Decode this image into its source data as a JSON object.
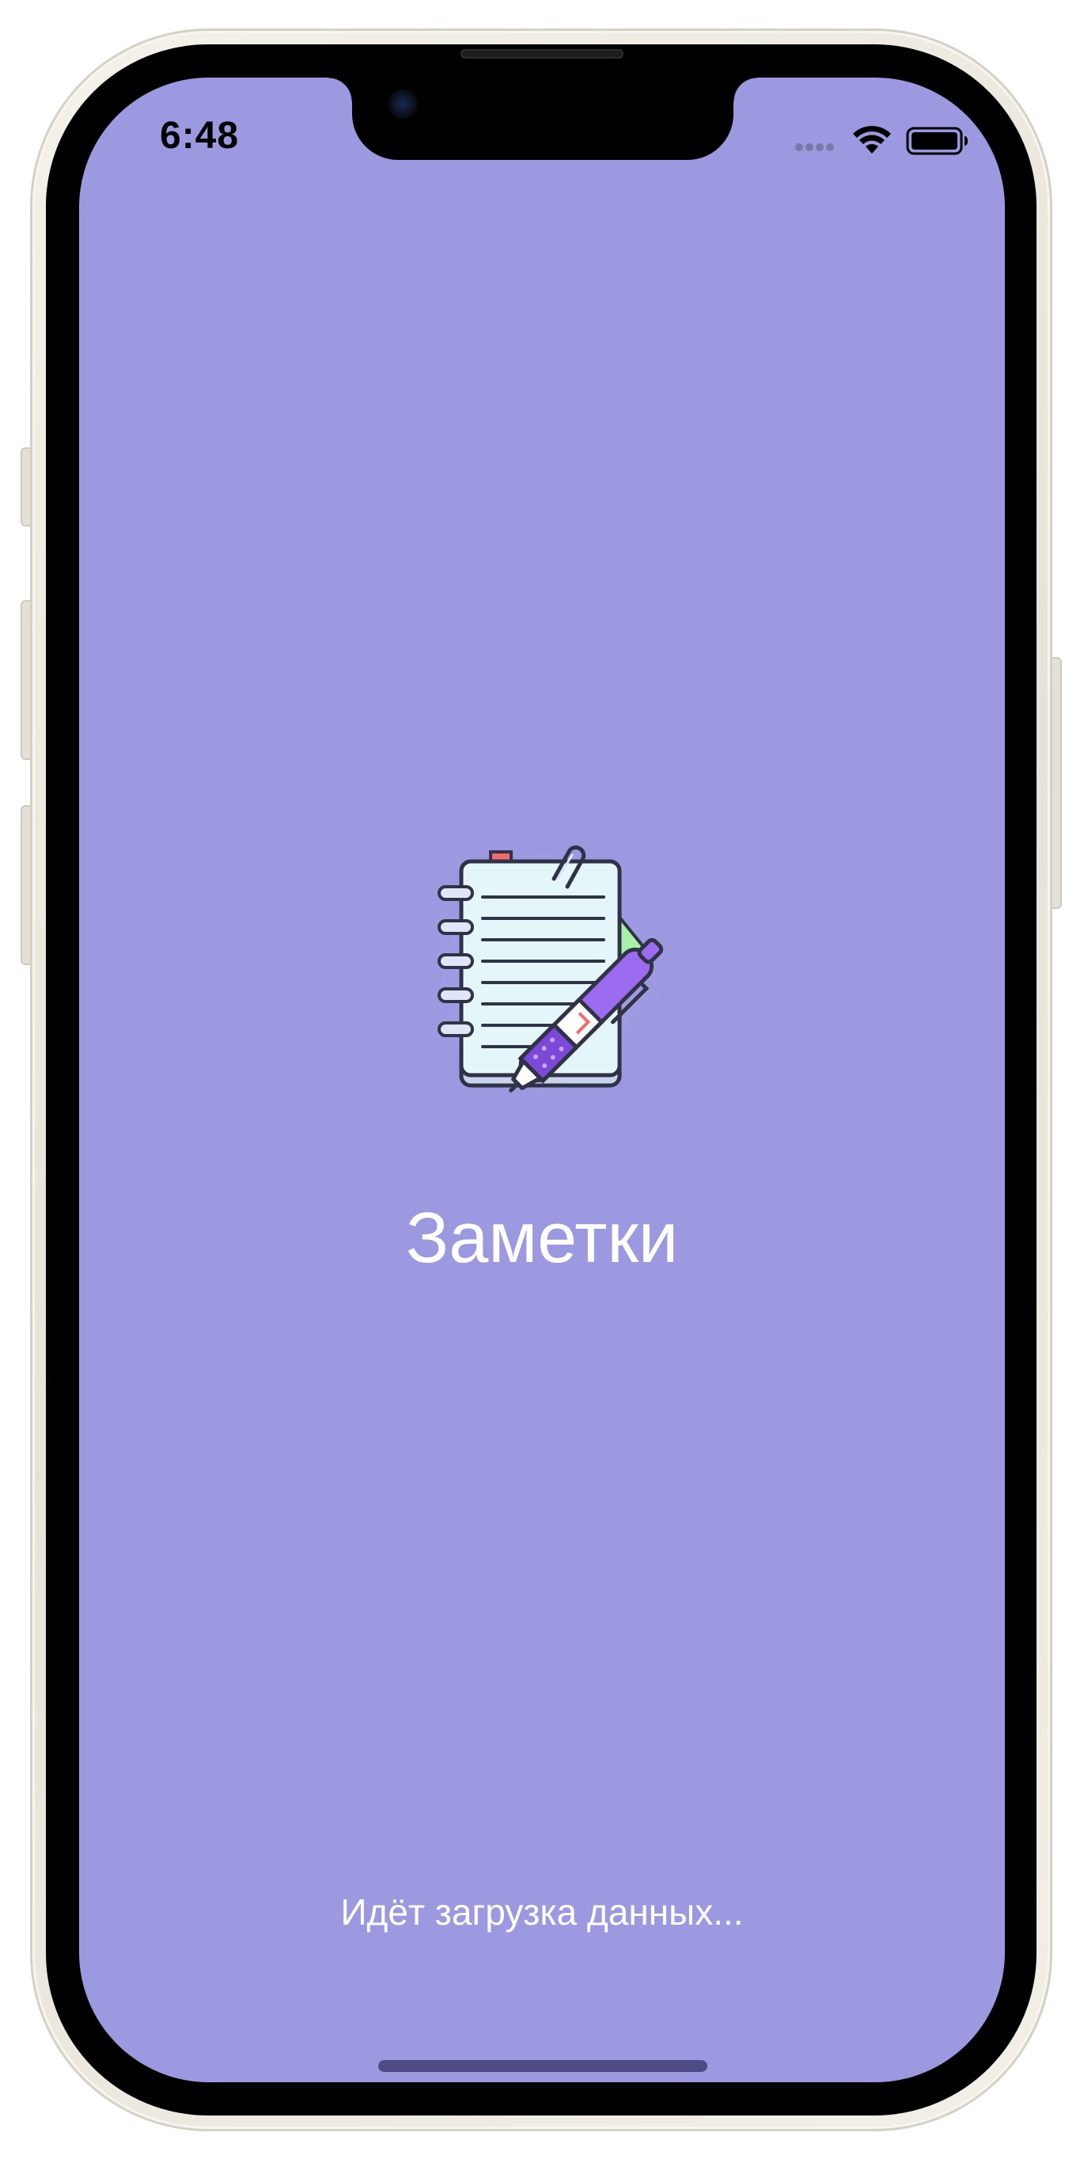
{
  "status_bar": {
    "time": "6:48",
    "icons": [
      "cellular-signal-icon",
      "wifi-icon",
      "battery-icon"
    ]
  },
  "splash": {
    "app_icon": "notebook-with-pen-icon",
    "title": "Заметки",
    "loading_message": "Идёт загрузка данных..."
  },
  "colors": {
    "background": "#9c99e1",
    "text": "#ffffff",
    "home_indicator": "#4e4b84",
    "device_frame": "#efebe3"
  }
}
